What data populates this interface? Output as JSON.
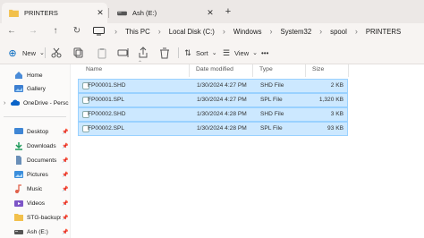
{
  "tabs": [
    {
      "label": "PRINTERS",
      "icon": "folder-icon",
      "close": "✕"
    },
    {
      "label": "Ash (E:)",
      "icon": "drive-icon",
      "close": "✕"
    }
  ],
  "new_tab": "+",
  "nav": {
    "back": "←",
    "forward": "→",
    "up": "↑",
    "refresh": "↻"
  },
  "breadcrumbs": [
    "This PC",
    "Local Disk (C:)",
    "Windows",
    "System32",
    "spool",
    "PRINTERS"
  ],
  "breadcrumb_separator": "›",
  "toolbar": {
    "new_label": "New",
    "sort_label": "Sort",
    "view_label": "View",
    "more": "•••",
    "dropdown": "⌄"
  },
  "sidebar": {
    "items": [
      {
        "label": "Home",
        "icon": "home-icon",
        "pin": ""
      },
      {
        "label": "Gallery",
        "icon": "gallery-icon",
        "pin": ""
      },
      {
        "label": "OneDrive - Persc",
        "icon": "onedrive-cloud-icon",
        "pin": ""
      },
      {
        "label": "Desktop",
        "icon": "desktop-icon",
        "pin": "📌"
      },
      {
        "label": "Downloads",
        "icon": "downloads-icon",
        "pin": "📌"
      },
      {
        "label": "Documents",
        "icon": "documents-icon",
        "pin": "📌"
      },
      {
        "label": "Pictures",
        "icon": "pictures-icon",
        "pin": "📌"
      },
      {
        "label": "Music",
        "icon": "music-icon",
        "pin": "📌"
      },
      {
        "label": "Videos",
        "icon": "videos-icon",
        "pin": "📌"
      },
      {
        "label": "STG-backups",
        "icon": "folder-icon",
        "pin": "📌"
      },
      {
        "label": "Ash (E:)",
        "icon": "drive-icon",
        "pin": "📌"
      }
    ]
  },
  "columns": {
    "name": "Name",
    "date": "Date modified",
    "type": "Type",
    "size": "Size"
  },
  "files": [
    {
      "name": "FP00001.SHD",
      "date": "1/30/2024 4:27 PM",
      "type": "SHD File",
      "size": "2 KB"
    },
    {
      "name": "FP00001.SPL",
      "date": "1/30/2024 4:27 PM",
      "type": "SPL File",
      "size": "1,320 KB"
    },
    {
      "name": "FP00002.SHD",
      "date": "1/30/2024 4:28 PM",
      "type": "SHD File",
      "size": "3 KB"
    },
    {
      "name": "FP00002.SPL",
      "date": "1/30/2024 4:28 PM",
      "type": "SPL File",
      "size": "93 KB"
    }
  ],
  "colors": {
    "accent": "#0067c0",
    "selection": "#cce8ff",
    "selection_border": "#99d1ff",
    "folder": "#f2c04b",
    "chrome": "#f7f4f2"
  }
}
